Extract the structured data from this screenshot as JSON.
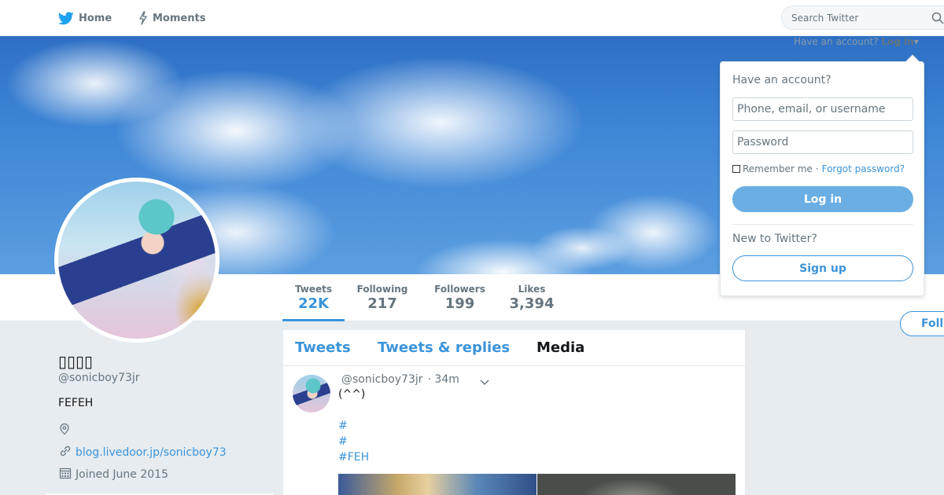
{
  "nav": {
    "home_label": "Home",
    "moments_label": "Moments",
    "search_placeholder": "Search Twitter"
  },
  "login_link": {
    "prefix": "Have an account?",
    "action": "Log in"
  },
  "login_dropdown": {
    "title": "Have an account?",
    "username_placeholder": "Phone, email, or username",
    "password_placeholder": "Password",
    "remember_label": "Remember me",
    "separator": "·",
    "forgot_label": "Forgot password?",
    "login_button": "Log in",
    "new_label": "New to Twitter?",
    "signup_button": "Sign up"
  },
  "stats": [
    {
      "label": "Tweets",
      "value": "22K"
    },
    {
      "label": "Following",
      "value": "217"
    },
    {
      "label": "Followers",
      "value": "199"
    },
    {
      "label": "Likes",
      "value": "3,394"
    }
  ],
  "follow_button": "Foll",
  "profile": {
    "name": "▯▯▯▯",
    "handle": "@sonicboy73jr",
    "bio": "FEFEH",
    "url": "blog.livedoor.jp/sonicboy73",
    "joined": "Joined June 2015"
  },
  "tabs": {
    "tweets": "Tweets",
    "replies": "Tweets & replies",
    "media": "Media"
  },
  "tweet": {
    "handle": "@sonicboy73jr",
    "time": "· 34m",
    "text": "(^^)",
    "hashtags": [
      "#",
      "#",
      "#FEH"
    ]
  },
  "colors": {
    "accent": "#3b94d9",
    "login_button": "#6aaee3",
    "background": "#e6ecf0"
  },
  "icons": {
    "home": "twitter-bird-icon",
    "moments": "lightning-icon",
    "search": "search-icon",
    "location": "location-pin-icon",
    "link": "link-icon",
    "calendar": "calendar-icon",
    "caret": "chevron-down-icon"
  }
}
